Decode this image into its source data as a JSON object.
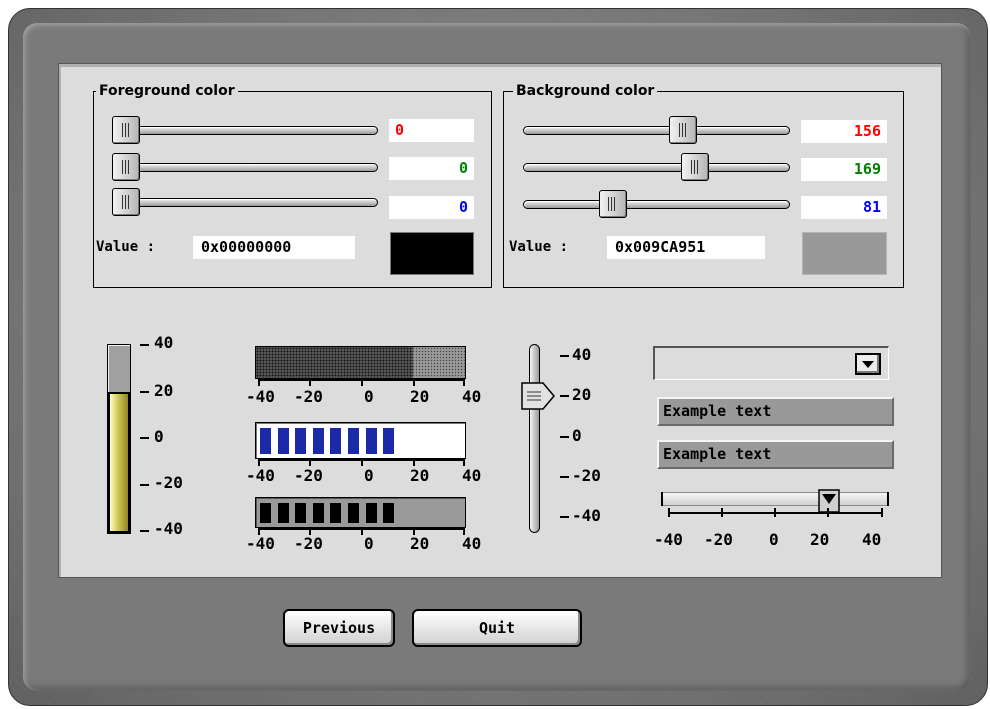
{
  "foreground": {
    "title": "Foreground color",
    "red": 0,
    "green": 0,
    "blue": 0,
    "red_label": "0",
    "green_label": "0",
    "blue_label": "0",
    "value_label": "Value :",
    "hex": "0x00000000",
    "swatch_color": "#000000"
  },
  "background": {
    "title": "Background color",
    "red": 156,
    "green": 169,
    "blue": 81,
    "red_label": "156",
    "green_label": "169",
    "blue_label": "81",
    "value_label": "Value :",
    "hex": "0x009CA951",
    "swatch_color": "#999999"
  },
  "colors": {
    "red": "#ff0000",
    "green": "#008000",
    "blue": "#0000ff"
  },
  "scale_labels": [
    "-40",
    "-20",
    "0",
    "20",
    "40"
  ],
  "vertical_gauge": {
    "level": 20,
    "labels": [
      "40",
      "20",
      "0",
      "-20",
      "-40"
    ]
  },
  "vertical_slider": {
    "value": 20,
    "labels": [
      "40",
      "20",
      "0",
      "-20",
      "-40"
    ]
  },
  "progress_dotted": {
    "value": 20
  },
  "progress_blue": {
    "value": 10,
    "segments": 8,
    "color": "#1a2aa8"
  },
  "progress_black": {
    "value": 10,
    "segments": 8
  },
  "combo": {
    "value": ""
  },
  "example_text_1": "Example text",
  "example_text_2": "Example text",
  "bottom_slider": {
    "value": 20
  },
  "buttons": {
    "previous": "Previous",
    "quit": "Quit"
  }
}
